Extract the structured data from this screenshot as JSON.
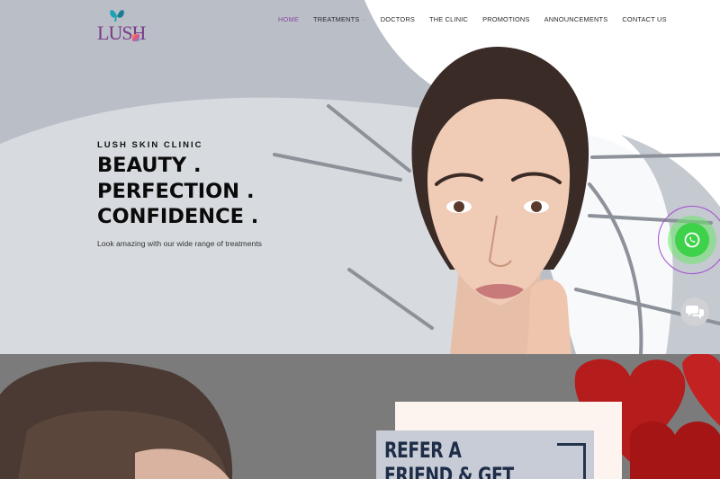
{
  "brand": {
    "logo_text": "LUSH"
  },
  "nav": {
    "items": [
      {
        "label": "HOME",
        "active": true
      },
      {
        "label": "TREATMENTS",
        "has_dropdown": true
      },
      {
        "label": "DOCTORS"
      },
      {
        "label": "THE CLINIC"
      },
      {
        "label": "PROMOTIONS"
      },
      {
        "label": "ANNOUNCEMENTS"
      },
      {
        "label": "CONTACT US"
      }
    ]
  },
  "hero": {
    "kicker": "LUSH SKIN CLINIC",
    "headline_lines": [
      "BEAUTY .",
      "PERFECTION .",
      "CONFIDENCE ."
    ],
    "subtitle": "Look amazing with our wide range of treatments"
  },
  "floating": {
    "whatsapp_icon": "whatsapp-icon",
    "chat_icon": "chat-bubbles-icon"
  },
  "promo": {
    "title_lines": [
      "REFER A",
      "FRIEND & GET"
    ]
  },
  "colors": {
    "accent": "#8a4ba0",
    "hero_bg": "#b9bec7",
    "whatsapp": "#3ed14a",
    "promo_title": "#1e2d47"
  }
}
